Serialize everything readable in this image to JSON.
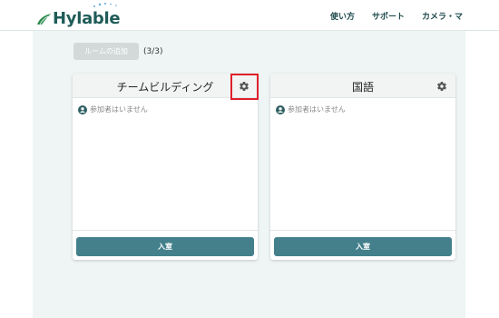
{
  "header": {
    "logo_text": "Hylable",
    "nav": [
      "使い方",
      "サポート",
      "カメラ・マ"
    ]
  },
  "toolbar": {
    "add_room_label": "ルームの追加",
    "room_count": "(3/3)"
  },
  "rooms": [
    {
      "title": "チームビルディング",
      "participants_text": "参加者はいません",
      "enter_label": "入室",
      "settings_highlighted": true
    },
    {
      "title": "国語",
      "participants_text": "参加者はいません",
      "enter_label": "入室",
      "settings_highlighted": false
    }
  ],
  "colors": {
    "brand": "#1f5c58",
    "enter_button": "#43808b",
    "highlight": "#e0202b",
    "background": "#eef5f4"
  },
  "icons": {
    "settings": "gear-icon",
    "participant": "user-circle-icon",
    "logo": "hylable-leaf-icon"
  }
}
